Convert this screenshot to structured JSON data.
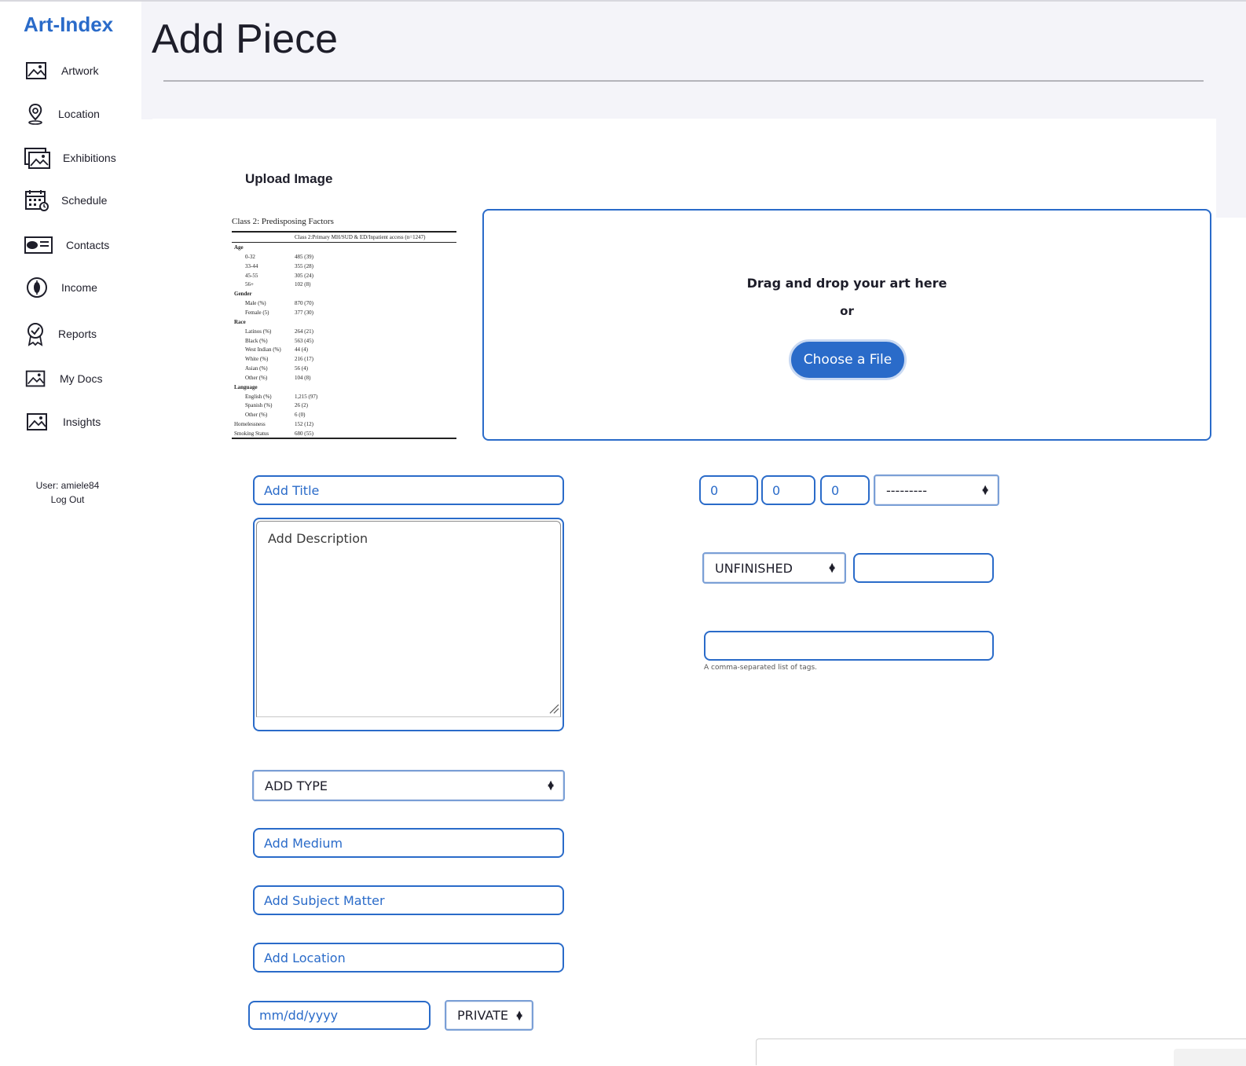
{
  "app": {
    "logo": "Art-Index"
  },
  "sidebar": {
    "items": [
      {
        "label": "Artwork",
        "icon": "image-icon"
      },
      {
        "label": "Location",
        "icon": "map-pin-icon"
      },
      {
        "label": "Exhibitions",
        "icon": "gallery-icon"
      },
      {
        "label": "Schedule",
        "icon": "calendar-clock-icon"
      },
      {
        "label": "Contacts",
        "icon": "contact-card-icon"
      },
      {
        "label": "Income",
        "icon": "dollar-coin-icon"
      },
      {
        "label": "Reports",
        "icon": "badge-check-icon"
      },
      {
        "label": "My Docs",
        "icon": "image-icon"
      },
      {
        "label": "Insights",
        "icon": "image-icon"
      }
    ],
    "user_label": "User: amiele84",
    "logout_label": "Log Out"
  },
  "page": {
    "title": "Add Piece"
  },
  "upload": {
    "label": "Upload Image",
    "dropzone_text": "Drag and drop your art here",
    "or_text": "or",
    "choose_button": "Choose a File",
    "preview": {
      "caption": "Class 2: Predisposing Factors",
      "column_header": "Class 2:Primary MH/SUD & ED/Inpatient access (n=1247)",
      "rows": [
        {
          "label": "Age",
          "value": "",
          "header": true
        },
        {
          "label": "0-32",
          "value": "485 (39)"
        },
        {
          "label": "33-44",
          "value": "355 (28)"
        },
        {
          "label": "45-55",
          "value": "305 (24)"
        },
        {
          "label": "56+",
          "value": "102 (8)"
        },
        {
          "label": "Gender",
          "value": "",
          "header": true
        },
        {
          "label": "Male (%)",
          "value": "870 (70)"
        },
        {
          "label": "Female (5)",
          "value": "377 (30)"
        },
        {
          "label": "Race",
          "value": "",
          "header": true
        },
        {
          "label": "Latinos (%)",
          "value": "264 (21)"
        },
        {
          "label": "Black (%)",
          "value": "563 (45)"
        },
        {
          "label": "West Indian (%)",
          "value": "44 (4)"
        },
        {
          "label": "White (%)",
          "value": "216 (17)"
        },
        {
          "label": "Asian (%)",
          "value": "56 (4)"
        },
        {
          "label": "Other (%)",
          "value": "104 (8)"
        },
        {
          "label": "Language",
          "value": "",
          "header": true
        },
        {
          "label": "English (%)",
          "value": "1,215 (97)"
        },
        {
          "label": "Spanish (%)",
          "value": "26 (2)"
        },
        {
          "label": "Other (%)",
          "value": "6 (0)"
        },
        {
          "label": "Homelessness",
          "value": "152 (12)",
          "flush": true
        },
        {
          "label": "Smoking Status",
          "value": "680 (55)",
          "flush": true
        }
      ]
    }
  },
  "form": {
    "title_placeholder": "Add Title",
    "description_placeholder": "Add Description",
    "type_select": "ADD TYPE",
    "medium_placeholder": "Add Medium",
    "subject_placeholder": "Add Subject Matter",
    "location_placeholder": "Add Location",
    "date_placeholder": "mm/dd/yyyy",
    "visibility_select": "PRIVATE",
    "dim1": "0",
    "dim2": "0",
    "dim3": "0",
    "unit_select": "---------",
    "status_select": "UNFINISHED",
    "status_extra": "",
    "tags_value": "",
    "tags_help": "A comma-separated list of tags."
  },
  "colors": {
    "accent": "#2a6bc9",
    "header_bg": "#f4f4f9"
  }
}
